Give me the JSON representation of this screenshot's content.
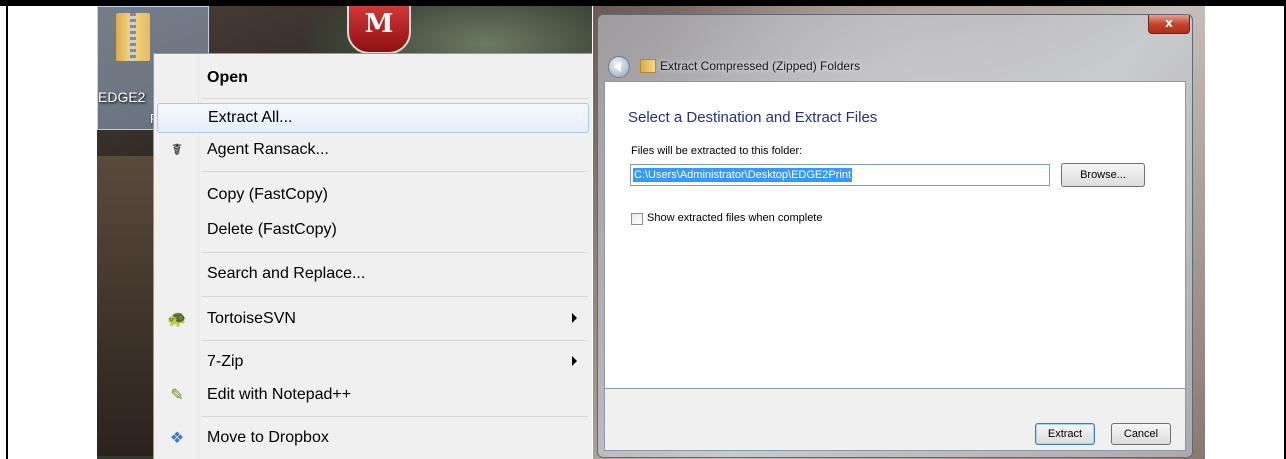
{
  "desktop": {
    "icon_label": "EDGE2",
    "icon_label_tail": "P"
  },
  "context_menu": {
    "items": [
      {
        "label": "Open",
        "bold": true,
        "icon": ""
      },
      {
        "label": "Extract All...",
        "hover": true,
        "icon": ""
      },
      {
        "label": "Agent Ransack...",
        "icon": "agent-ransack-icon"
      },
      {
        "label": "Copy  (FastCopy)",
        "icon": ""
      },
      {
        "label": "Delete (FastCopy)",
        "icon": ""
      },
      {
        "label": "Search and Replace...",
        "icon": ""
      },
      {
        "label": "TortoiseSVN",
        "icon": "tortoisesvn-icon",
        "submenu": true
      },
      {
        "label": "7-Zip",
        "icon": "",
        "submenu": true
      },
      {
        "label": "Edit with Notepad++",
        "icon": "notepadpp-icon"
      },
      {
        "label": "Move to Dropbox",
        "icon": "dropbox-icon"
      }
    ]
  },
  "dialog": {
    "title": "Extract Compressed (Zipped) Folders",
    "close_label": "x",
    "heading": "Select a Destination and Extract Files",
    "destination_label": "Files will be extracted to this folder:",
    "destination_value": "C:\\Users\\Administrator\\Desktop\\EDGE2Print",
    "browse_label": "Browse...",
    "show_files_label": "Show extracted files when complete",
    "show_files_checked": false,
    "extract_label": "Extract",
    "cancel_label": "Cancel"
  },
  "colors": {
    "heading": "#1e3287",
    "selection": "#3399ff",
    "close_button": "#c6432c"
  }
}
